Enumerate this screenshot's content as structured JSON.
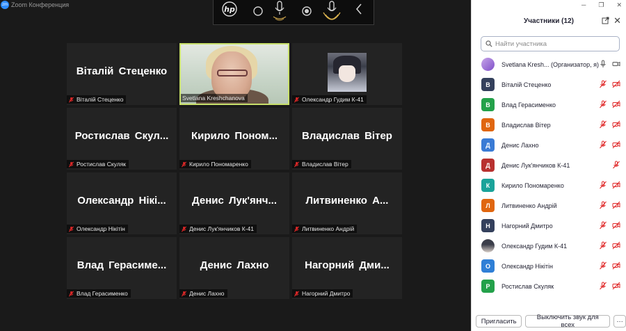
{
  "window": {
    "title": "Zoom Конференция",
    "logo_text": "zm"
  },
  "hpbar": {
    "icons": [
      "hp-logo-icon",
      "circle-icon",
      "microphone-icon",
      "record-icon",
      "microphone-active-icon",
      "chevron-left-icon"
    ]
  },
  "tiles": [
    {
      "name": "Віталій Стеценко",
      "label": "Віталій Стеценко",
      "kind": "name"
    },
    {
      "name": "",
      "label": "Svetlana Kreshchanova",
      "kind": "camera"
    },
    {
      "name": "",
      "label": "Олександр Гудим К-41",
      "kind": "avatar"
    },
    {
      "name": "Ростислав Скул...",
      "label": "Ростислав Скуляк",
      "kind": "name"
    },
    {
      "name": "Кирило Поном...",
      "label": "Кирило Пономаренко",
      "kind": "name"
    },
    {
      "name": "Владислав Вітер",
      "label": "Владислав Вітер",
      "kind": "name"
    },
    {
      "name": "Олександр Нікі...",
      "label": "Олександр Нікітін",
      "kind": "name"
    },
    {
      "name": "Денис Лук'янч...",
      "label": "Денис Лук'янчиков К-41",
      "kind": "name"
    },
    {
      "name": "Литвиненко А...",
      "label": "Литвиненко Андрій",
      "kind": "name"
    },
    {
      "name": "Влад Герасиме...",
      "label": "Влад Герасименко",
      "kind": "name"
    },
    {
      "name": "Денис Лахно",
      "label": "Денис Лахно",
      "kind": "name"
    },
    {
      "name": "Нагорний Дми...",
      "label": "Нагорний Дмитро",
      "kind": "name"
    }
  ],
  "panel": {
    "title": "Участники (12)",
    "search_placeholder": "Найти участника",
    "invite_label": "Пригласить",
    "mute_all_label": "Выключить звук для всех",
    "more_label": "···",
    "participants": [
      {
        "name": "Svetlana Kresh... (Организатор, я)",
        "initial": "",
        "color": "#9b6bd9",
        "kind": "host"
      },
      {
        "name": "Віталій Стеценко",
        "initial": "В",
        "color": "#34405c",
        "kind": "muted"
      },
      {
        "name": "Влад Герасименко",
        "initial": "В",
        "color": "#23a14a",
        "kind": "muted"
      },
      {
        "name": "Владислав Вітер",
        "initial": "В",
        "color": "#e0660f",
        "kind": "muted"
      },
      {
        "name": "Денис Лахно",
        "initial": "Д",
        "color": "#3a7bd5",
        "kind": "muted"
      },
      {
        "name": "Денис Лук'янчиков К-41",
        "initial": "Д",
        "color": "#b8312f",
        "kind": "mic-only"
      },
      {
        "name": "Кирило Пономаренко",
        "initial": "К",
        "color": "#1aa39a",
        "kind": "muted"
      },
      {
        "name": "Литвиненко Андрій",
        "initial": "Л",
        "color": "#e0660f",
        "kind": "muted"
      },
      {
        "name": "Нагорний Дмитро",
        "initial": "Н",
        "color": "#34405c",
        "kind": "muted"
      },
      {
        "name": "Олександр Гудим К-41",
        "initial": "",
        "color": "#7d7f8a",
        "kind": "photo"
      },
      {
        "name": "Олександр Нікітін",
        "initial": "О",
        "color": "#2f7fd6",
        "kind": "muted"
      },
      {
        "name": "Ростислав Скуляк",
        "initial": "Р",
        "color": "#23a14a",
        "kind": "muted"
      }
    ]
  },
  "colors": {
    "active_speaker_border": "#c8e06b",
    "muted_red": "#e02828",
    "tile_bg": "#232323",
    "grid_bg": "#1a1a1a"
  }
}
